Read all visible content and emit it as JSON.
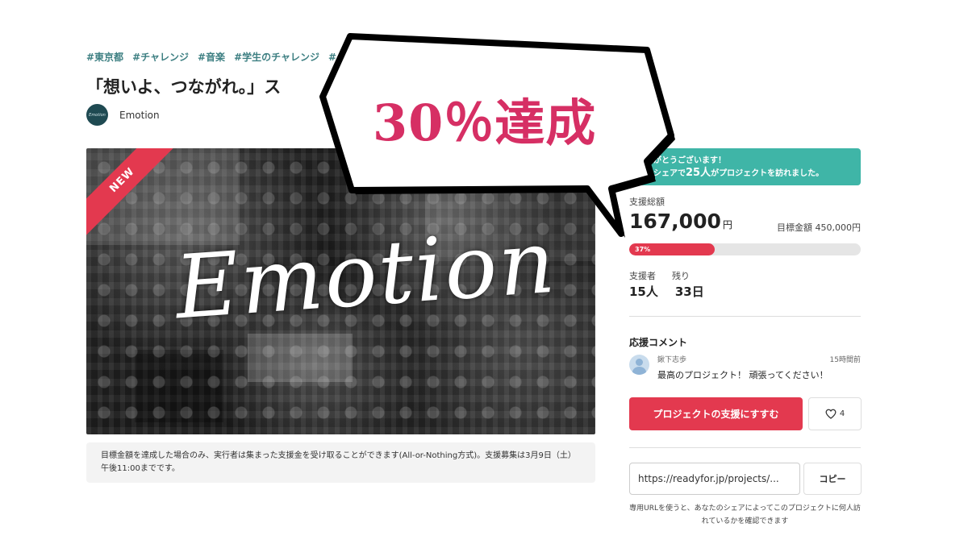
{
  "tags": [
    "#東京都",
    "#チャレンジ",
    "#音楽",
    "#学生のチャレンジ",
    "#イ"
  ],
  "project": {
    "title": "「想いよ、つながれ。」ス",
    "owner_name": "Emotion",
    "owner_avatar_text": "Emotion"
  },
  "hero": {
    "badge": "NEW",
    "logo_text": "Emotion"
  },
  "notice": {
    "text": "目標金額を達成した場合のみ、実行者は集まった支援金を受け取ることができます(All-or-Nothing方式)。支援募集は3月9日（土）午後11:00までです。"
  },
  "thanks": {
    "line1": "りがとうございます！",
    "line2_prefix": "のシェアで",
    "line2_count": "25人",
    "line2_suffix": "がプロジェクトを訪れました。"
  },
  "funding": {
    "total_label": "支援総額",
    "total_amount": "167,000",
    "currency": "円",
    "goal_text": "目標金額 450,000円",
    "progress_percent": 37,
    "progress_label": "37%"
  },
  "stats": {
    "supporters_label": "支援者",
    "supporters_value": "15人",
    "remaining_label": "残り",
    "remaining_value": "33日"
  },
  "comments": {
    "heading": "応援コメント",
    "items": [
      {
        "name": "鍬下志歩",
        "time": "15時間前",
        "body": "最高のプロジェクト！ 頑張ってください！"
      }
    ]
  },
  "actions": {
    "support_label": "プロジェクトの支援にすすむ",
    "like_count": "4"
  },
  "share": {
    "url_value": "https://readyfor.jp/projects/...",
    "copy_label": "コピー",
    "help_text": "専用URLを使うと、あなたのシェアによってこのプロジェクトに何人訪れているかを確認できます"
  },
  "overlay": {
    "bubble_text": "30％達成"
  },
  "colors": {
    "accent_red": "#e3394f",
    "teal": "#3fb5a7",
    "tag_teal": "#3d7f82",
    "bubble_text": "#d62f64"
  }
}
